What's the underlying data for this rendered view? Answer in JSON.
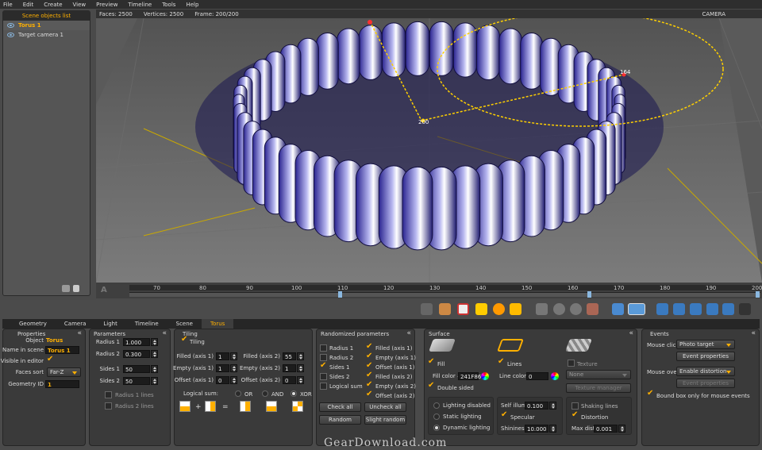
{
  "menu": [
    "File",
    "Edit",
    "Create",
    "View",
    "Preview",
    "Timeline",
    "Tools",
    "Help"
  ],
  "scene": {
    "title": "Scene objects list",
    "items": [
      {
        "label": "Torus 1",
        "selected": true
      },
      {
        "label": "Target camera 1",
        "selected": false
      }
    ]
  },
  "viewport": {
    "faces": "Faces: 2500",
    "vertices": "Vertices: 2500",
    "frame": "Frame: 200/200",
    "camera": "CAMERA",
    "marker_a": "200",
    "marker_b": "164"
  },
  "timeline": {
    "letter": "A",
    "ticks": [
      "70",
      "80",
      "90",
      "100",
      "110",
      "120",
      "130",
      "140",
      "150",
      "160",
      "170",
      "180",
      "190",
      "200"
    ]
  },
  "tabs": [
    "Geometry",
    "Camera",
    "Light",
    "Timeline",
    "Scene",
    "Torus"
  ],
  "properties": {
    "title": "Properties",
    "object_label": "Object",
    "object_value": "Torus",
    "name_label": "Name in scene",
    "name_value": "Torus 1",
    "visible_label": "Visible in editor",
    "faces_sort_label": "Faces sort",
    "faces_sort_value": "Far-Z",
    "geometry_id_label": "Geometry ID",
    "geometry_id_value": "1"
  },
  "parameters": {
    "title": "Parameters",
    "radius1_label": "Radius 1",
    "radius1_value": "1.000",
    "radius2_label": "Radius 2",
    "radius2_value": "0.300",
    "sides1_label": "Sides 1",
    "sides1_value": "50",
    "sides2_label": "Sides 2",
    "sides2_value": "50",
    "radius1_lines": "Radius 1 lines",
    "radius2_lines": "Radius 2 lines"
  },
  "tiling": {
    "title": "Tiling",
    "tiling_label": "Tiling",
    "filled1_label": "Filled (axis 1)",
    "filled1_value": "1",
    "empty1_label": "Empty (axis 1)",
    "empty1_value": "1",
    "offset1_label": "Offset (axis 1)",
    "offset1_value": "0",
    "filled2_label": "Filled (axis 2)",
    "filled2_value": "55",
    "empty2_label": "Empty (axis 2)",
    "empty2_value": "1",
    "offset2_label": "Offset (axis 2)",
    "offset2_value": "0",
    "logical_label": "Logical sum:",
    "or": "OR",
    "and": "AND",
    "xor": "XOR",
    "plus": "+",
    "equals": "="
  },
  "randomized": {
    "title": "Randomized parameters",
    "left": [
      "Radius 1",
      "Radius 2",
      "Sides 1",
      "Sides 2",
      "Logical sum"
    ],
    "right": [
      "Filled (axis 1)",
      "Empty (axis 1)",
      "Offset (axis 1)",
      "Filled (axis 2)",
      "Empty (axis 2)",
      "Offset (axis 2)"
    ],
    "check_all": "Check all",
    "uncheck_all": "Uncheck all",
    "random": "Random",
    "slight_random": "Slight random"
  },
  "surface": {
    "title": "Surface",
    "fill": "Fill",
    "lines": "Lines",
    "texture": "Texture",
    "fill_color_label": "Fill color #",
    "fill_color_value": "241F86",
    "line_color_label": "Line color #",
    "line_color_value": "0",
    "texture_value": "None",
    "texture_manager": "Texture manager",
    "double_sided": "Double sided",
    "lighting_disabled": "Lighting disabled",
    "static_lighting": "Static lighting",
    "dynamic_lighting": "Dynamic lighting",
    "self_illum_label": "Self illum.",
    "self_illum_value": "0.100",
    "specular": "Specular",
    "shininess_label": "Shininess",
    "shininess_value": "10.000",
    "shaking_lines": "Shaking lines",
    "distortion": "Distortion",
    "max_dist_label": "Max dist.",
    "max_dist_value": "0.001"
  },
  "events": {
    "title": "Events",
    "mouse_click_label": "Mouse click",
    "mouse_click_value": "Photo target",
    "event_properties": "Event properties",
    "mouse_over_label": "Mouse over",
    "mouse_over_value": "Enable distortion",
    "event_properties2": "Event properties",
    "bound_box": "Bound box only for mouse events"
  },
  "colors": {
    "accent": "#ffb000",
    "torus": "#241F86"
  },
  "watermark": "GearDownload.com"
}
